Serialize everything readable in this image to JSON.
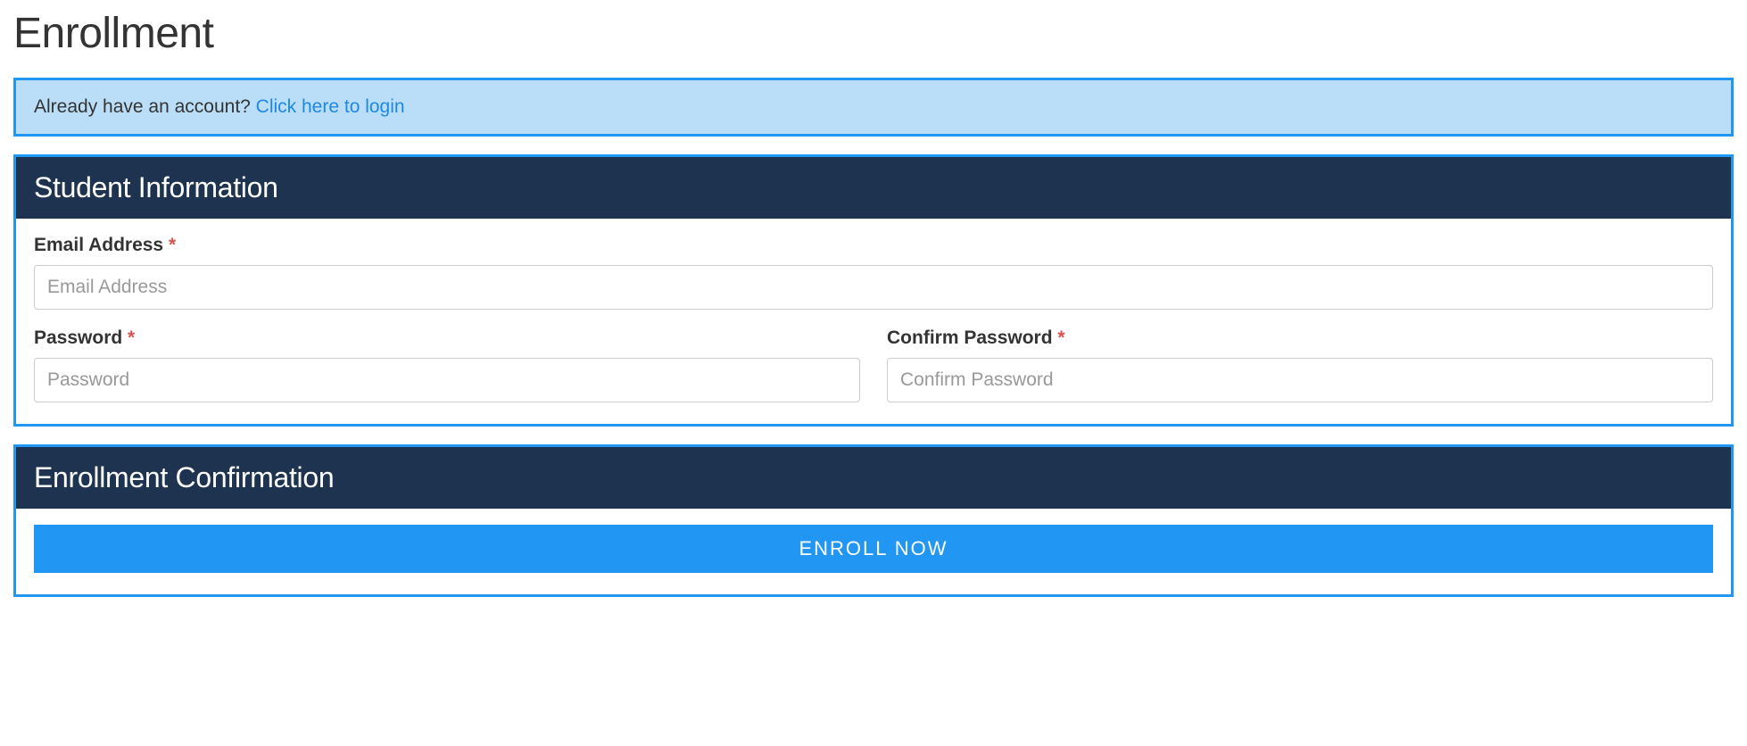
{
  "page_title": "Enrollment",
  "alert": {
    "text": "Already have an account? ",
    "link_text": "Click here to login"
  },
  "panel_student": {
    "header": "Student Information",
    "email_label": "Email Address ",
    "email_placeholder": "Email Address",
    "password_label": "Password ",
    "password_placeholder": "Password",
    "confirm_password_label": "Confirm Password ",
    "confirm_password_placeholder": "Confirm Password",
    "required_mark": "*"
  },
  "panel_confirm": {
    "header": "Enrollment Confirmation",
    "button_label": "ENROLL NOW"
  }
}
